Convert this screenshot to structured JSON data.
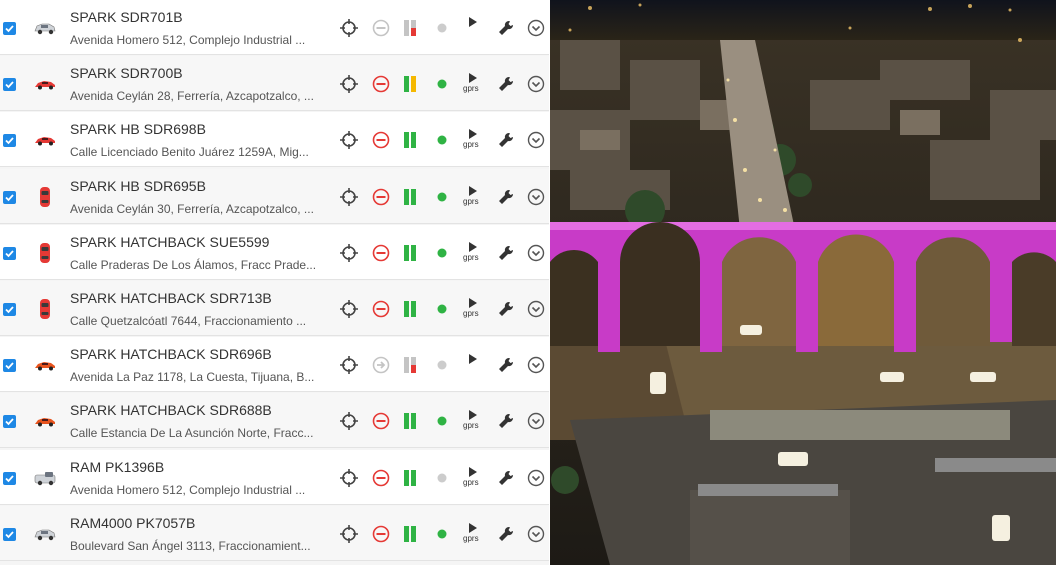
{
  "vehicles": [
    {
      "name": "SPARK SDR701B",
      "address": "Avenida Homero 512, Complejo Industrial ...",
      "checked": true,
      "car": "sedan",
      "car_color": "#cfd3d8",
      "status": "inactive",
      "signal": "red",
      "dot_color": "#cccccc",
      "gprs_label": ""
    },
    {
      "name": "SPARK SDR700B",
      "address": "Avenida Ceylán 28, Ferrería, Azcapotzalco, ...",
      "checked": true,
      "car": "sport",
      "car_color": "#e53935",
      "status": "stop",
      "signal": "yellow",
      "dot_color": "#2fb344",
      "gprs_label": "gprs"
    },
    {
      "name": "SPARK HB SDR698B",
      "address": "Calle Licenciado Benito Juárez 1259A, Mig...",
      "checked": true,
      "car": "sport",
      "car_color": "#e53935",
      "status": "stop",
      "signal": "green",
      "dot_color": "#2fb344",
      "gprs_label": "gprs"
    },
    {
      "name": "SPARK HB SDR695B",
      "address": "Avenida Ceylán 30, Ferrería, Azcapotzalco, ...",
      "checked": true,
      "car": "top",
      "car_color": "#e53935",
      "status": "stop",
      "signal": "green",
      "dot_color": "#2fb344",
      "gprs_label": "gprs"
    },
    {
      "name": "SPARK HATCHBACK SUE5599",
      "address": "Calle Praderas De Los Álamos, Fracc Prade...",
      "checked": true,
      "car": "top",
      "car_color": "#e53935",
      "status": "stop",
      "signal": "green",
      "dot_color": "#2fb344",
      "gprs_label": "gprs"
    },
    {
      "name": "SPARK HATCHBACK SDR713B",
      "address": "Calle Quetzalcóatl 7644, Fraccionamiento ...",
      "checked": true,
      "car": "top",
      "car_color": "#e53935",
      "status": "stop",
      "signal": "green",
      "dot_color": "#2fb344",
      "gprs_label": "gprs"
    },
    {
      "name": "SPARK HATCHBACK SDR696B",
      "address": "Avenida La Paz 1178, La Cuesta, Tijuana, B...",
      "checked": true,
      "car": "sport",
      "car_color": "#e8541e",
      "status": "arrow",
      "signal": "red",
      "dot_color": "#cccccc",
      "gprs_label": ""
    },
    {
      "name": "SPARK HATCHBACK SDR688B",
      "address": "Calle Estancia De La Asunción Norte, Fracc...",
      "checked": true,
      "car": "sport",
      "car_color": "#e8541e",
      "status": "stop",
      "signal": "green",
      "dot_color": "#2fb344",
      "gprs_label": "gprs"
    },
    {
      "name": "RAM PK1396B",
      "address": "Avenida Homero 512, Complejo Industrial ...",
      "checked": true,
      "car": "truck",
      "car_color": "#cfd3d8",
      "status": "stop",
      "signal": "green",
      "dot_color": "#cccccc",
      "gprs_label": "gprs"
    },
    {
      "name": "RAM4000 PK7057B",
      "address": "Boulevard San Ángel 3113, Fraccionamient...",
      "checked": true,
      "car": "sedan",
      "car_color": "#cfd3d8",
      "status": "stop",
      "signal": "green",
      "dot_color": "#2fb344",
      "gprs_label": "gprs"
    }
  ],
  "colors": {
    "checkbox": "#1e88e5",
    "stop_red": "#e53935",
    "signal_green": "#2fb344",
    "signal_yellow": "#f5b800",
    "inactive_grey": "#c4c4c4",
    "aqueduct_magenta": "#d23fd0"
  },
  "icons": {
    "locate": "crosshair-icon",
    "stop": "stop-icon",
    "signal": "signal-bars-icon",
    "play": "play-icon",
    "wrench": "wrench-icon",
    "menu": "chevron-circle-icon"
  }
}
